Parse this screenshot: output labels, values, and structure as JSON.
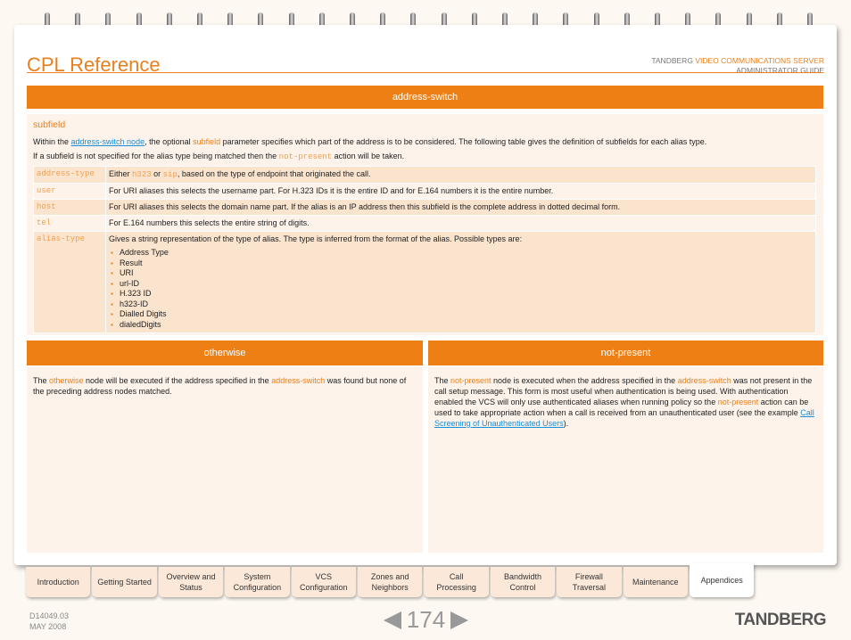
{
  "header": {
    "title": "CPL Reference",
    "brand": "TANDBERG",
    "product": "VIDEO COMMUNICATIONS SERVER",
    "guide": "ADMINISTRATOR GUIDE"
  },
  "section": {
    "title": "address-switch",
    "heading": "subfield",
    "intro1_a": "Within the ",
    "intro1_link": "address-switch node",
    "intro1_b": ", the optional ",
    "intro1_kw": "subfield",
    "intro1_c": " parameter specifies which part of the address is to be considered.  The following table gives the definition of subfields for each alias type.",
    "intro2_a": "If a subfield is not specified for the alias type being matched then the ",
    "intro2_code": "not-present",
    "intro2_b": " action will be taken.",
    "rows": [
      {
        "key": "address-type",
        "a": "Either ",
        "c1": "h323",
        "b": " or ",
        "c2": "sip",
        "c": ", based on the type of endpoint that originated the call."
      },
      {
        "key": "user",
        "text": "For URI aliases this selects the username part. For H.323 IDs it is the entire ID and for E.164 numbers it is the entire number."
      },
      {
        "key": "host",
        "text": "For URI aliases this selects the domain name part. If the alias is an IP address then this subfield is the complete address in dotted decimal form."
      },
      {
        "key": "tel",
        "text": "For E.164 numbers this selects the entire string of digits."
      },
      {
        "key": "alias-type",
        "text": "Gives a string representation of the type of alias. The type is inferred from the format of the alias. Possible types are:",
        "items": [
          "Address Type",
          "Result",
          "URI",
          "url-ID",
          "H.323 ID",
          "h323-ID",
          "Dialled Digits",
          "dialedDigits"
        ]
      }
    ]
  },
  "otherwise": {
    "title": "otherwise",
    "a": "The ",
    "k1": "otherwise",
    "b": " node will be executed if the address specified in the ",
    "k2": "address-switch",
    "c": " was found but none of the preceding address nodes matched."
  },
  "notpresent": {
    "title": "not-present",
    "a": "The ",
    "k1": "not-present",
    "b": " node is executed when the address specified in the ",
    "k2": "address-switch",
    "c": " was not present in the call setup message. This form is most useful when authentication is being used. With authentication enabled the VCS will only use authenticated aliases when running policy so the ",
    "k3": "not-present",
    "d": " action can be used to take appropriate action when a call is received from an unauthenticated user (see the example ",
    "link": "Call Screening of Unauthenticated Users",
    "e": ")."
  },
  "tabs": [
    [
      "Introduction"
    ],
    [
      "Getting Started"
    ],
    [
      "Overview and",
      "Status"
    ],
    [
      "System",
      "Configuration"
    ],
    [
      "VCS",
      "Configuration"
    ],
    [
      "Zones and",
      "Neighbors"
    ],
    [
      "Call",
      "Processing"
    ],
    [
      "Bandwidth",
      "Control"
    ],
    [
      "Firewall",
      "Traversal"
    ],
    [
      "Maintenance"
    ],
    [
      "Appendices"
    ]
  ],
  "active_tab": "Appendices",
  "footer": {
    "doc": "D14049.03",
    "date": "MAY 2008",
    "page": "174",
    "logo": "TANDBERG"
  },
  "colors": {
    "accent": "#ee7f14",
    "panel": "#fdf3ea",
    "row": "#fbe4ce",
    "link": "#1a8ed6"
  }
}
